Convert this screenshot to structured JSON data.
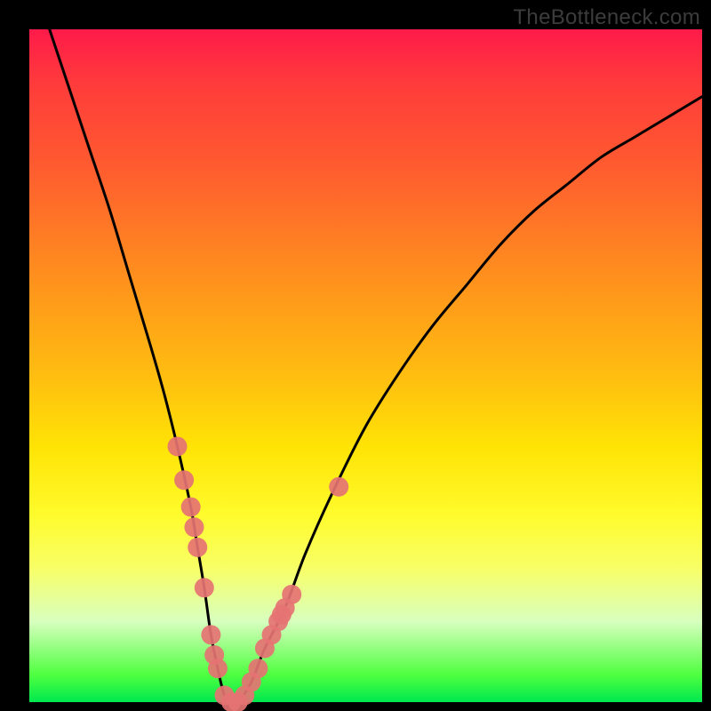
{
  "watermark": "TheBottleneck.com",
  "colors": {
    "gradient_top": "#ff1a4a",
    "gradient_mid": "#ffe305",
    "gradient_bottom": "#00e84f",
    "curve": "#000000",
    "points": "#e57373"
  },
  "chart_data": {
    "type": "line",
    "title": "",
    "xlabel": "",
    "ylabel": "",
    "xlim": [
      0,
      100
    ],
    "ylim": [
      0,
      100
    ],
    "x": [
      3,
      6,
      9,
      12,
      15,
      18,
      20,
      22,
      24,
      25,
      26,
      27,
      28,
      29,
      30,
      31,
      33,
      35,
      38,
      41,
      45,
      50,
      55,
      60,
      65,
      70,
      75,
      80,
      85,
      90,
      95,
      100
    ],
    "y": [
      100,
      91,
      82,
      73,
      63,
      53,
      46,
      38,
      29,
      23,
      17,
      10,
      5,
      1,
      0,
      0,
      3,
      8,
      14,
      22,
      31,
      41,
      49,
      56,
      62,
      68,
      73,
      77,
      81,
      84,
      87,
      90
    ],
    "scatter_points": [
      {
        "x": 22,
        "y": 38
      },
      {
        "x": 23,
        "y": 33
      },
      {
        "x": 24,
        "y": 29
      },
      {
        "x": 24.5,
        "y": 26
      },
      {
        "x": 25,
        "y": 23
      },
      {
        "x": 26,
        "y": 17
      },
      {
        "x": 27,
        "y": 10
      },
      {
        "x": 27.5,
        "y": 7
      },
      {
        "x": 28,
        "y": 5
      },
      {
        "x": 29,
        "y": 1
      },
      {
        "x": 30,
        "y": 0
      },
      {
        "x": 31,
        "y": 0
      },
      {
        "x": 32,
        "y": 1
      },
      {
        "x": 33,
        "y": 3
      },
      {
        "x": 34,
        "y": 5
      },
      {
        "x": 35,
        "y": 8
      },
      {
        "x": 36,
        "y": 10
      },
      {
        "x": 37,
        "y": 12
      },
      {
        "x": 37.5,
        "y": 13
      },
      {
        "x": 38,
        "y": 14
      },
      {
        "x": 39,
        "y": 16
      },
      {
        "x": 46,
        "y": 32
      }
    ]
  }
}
